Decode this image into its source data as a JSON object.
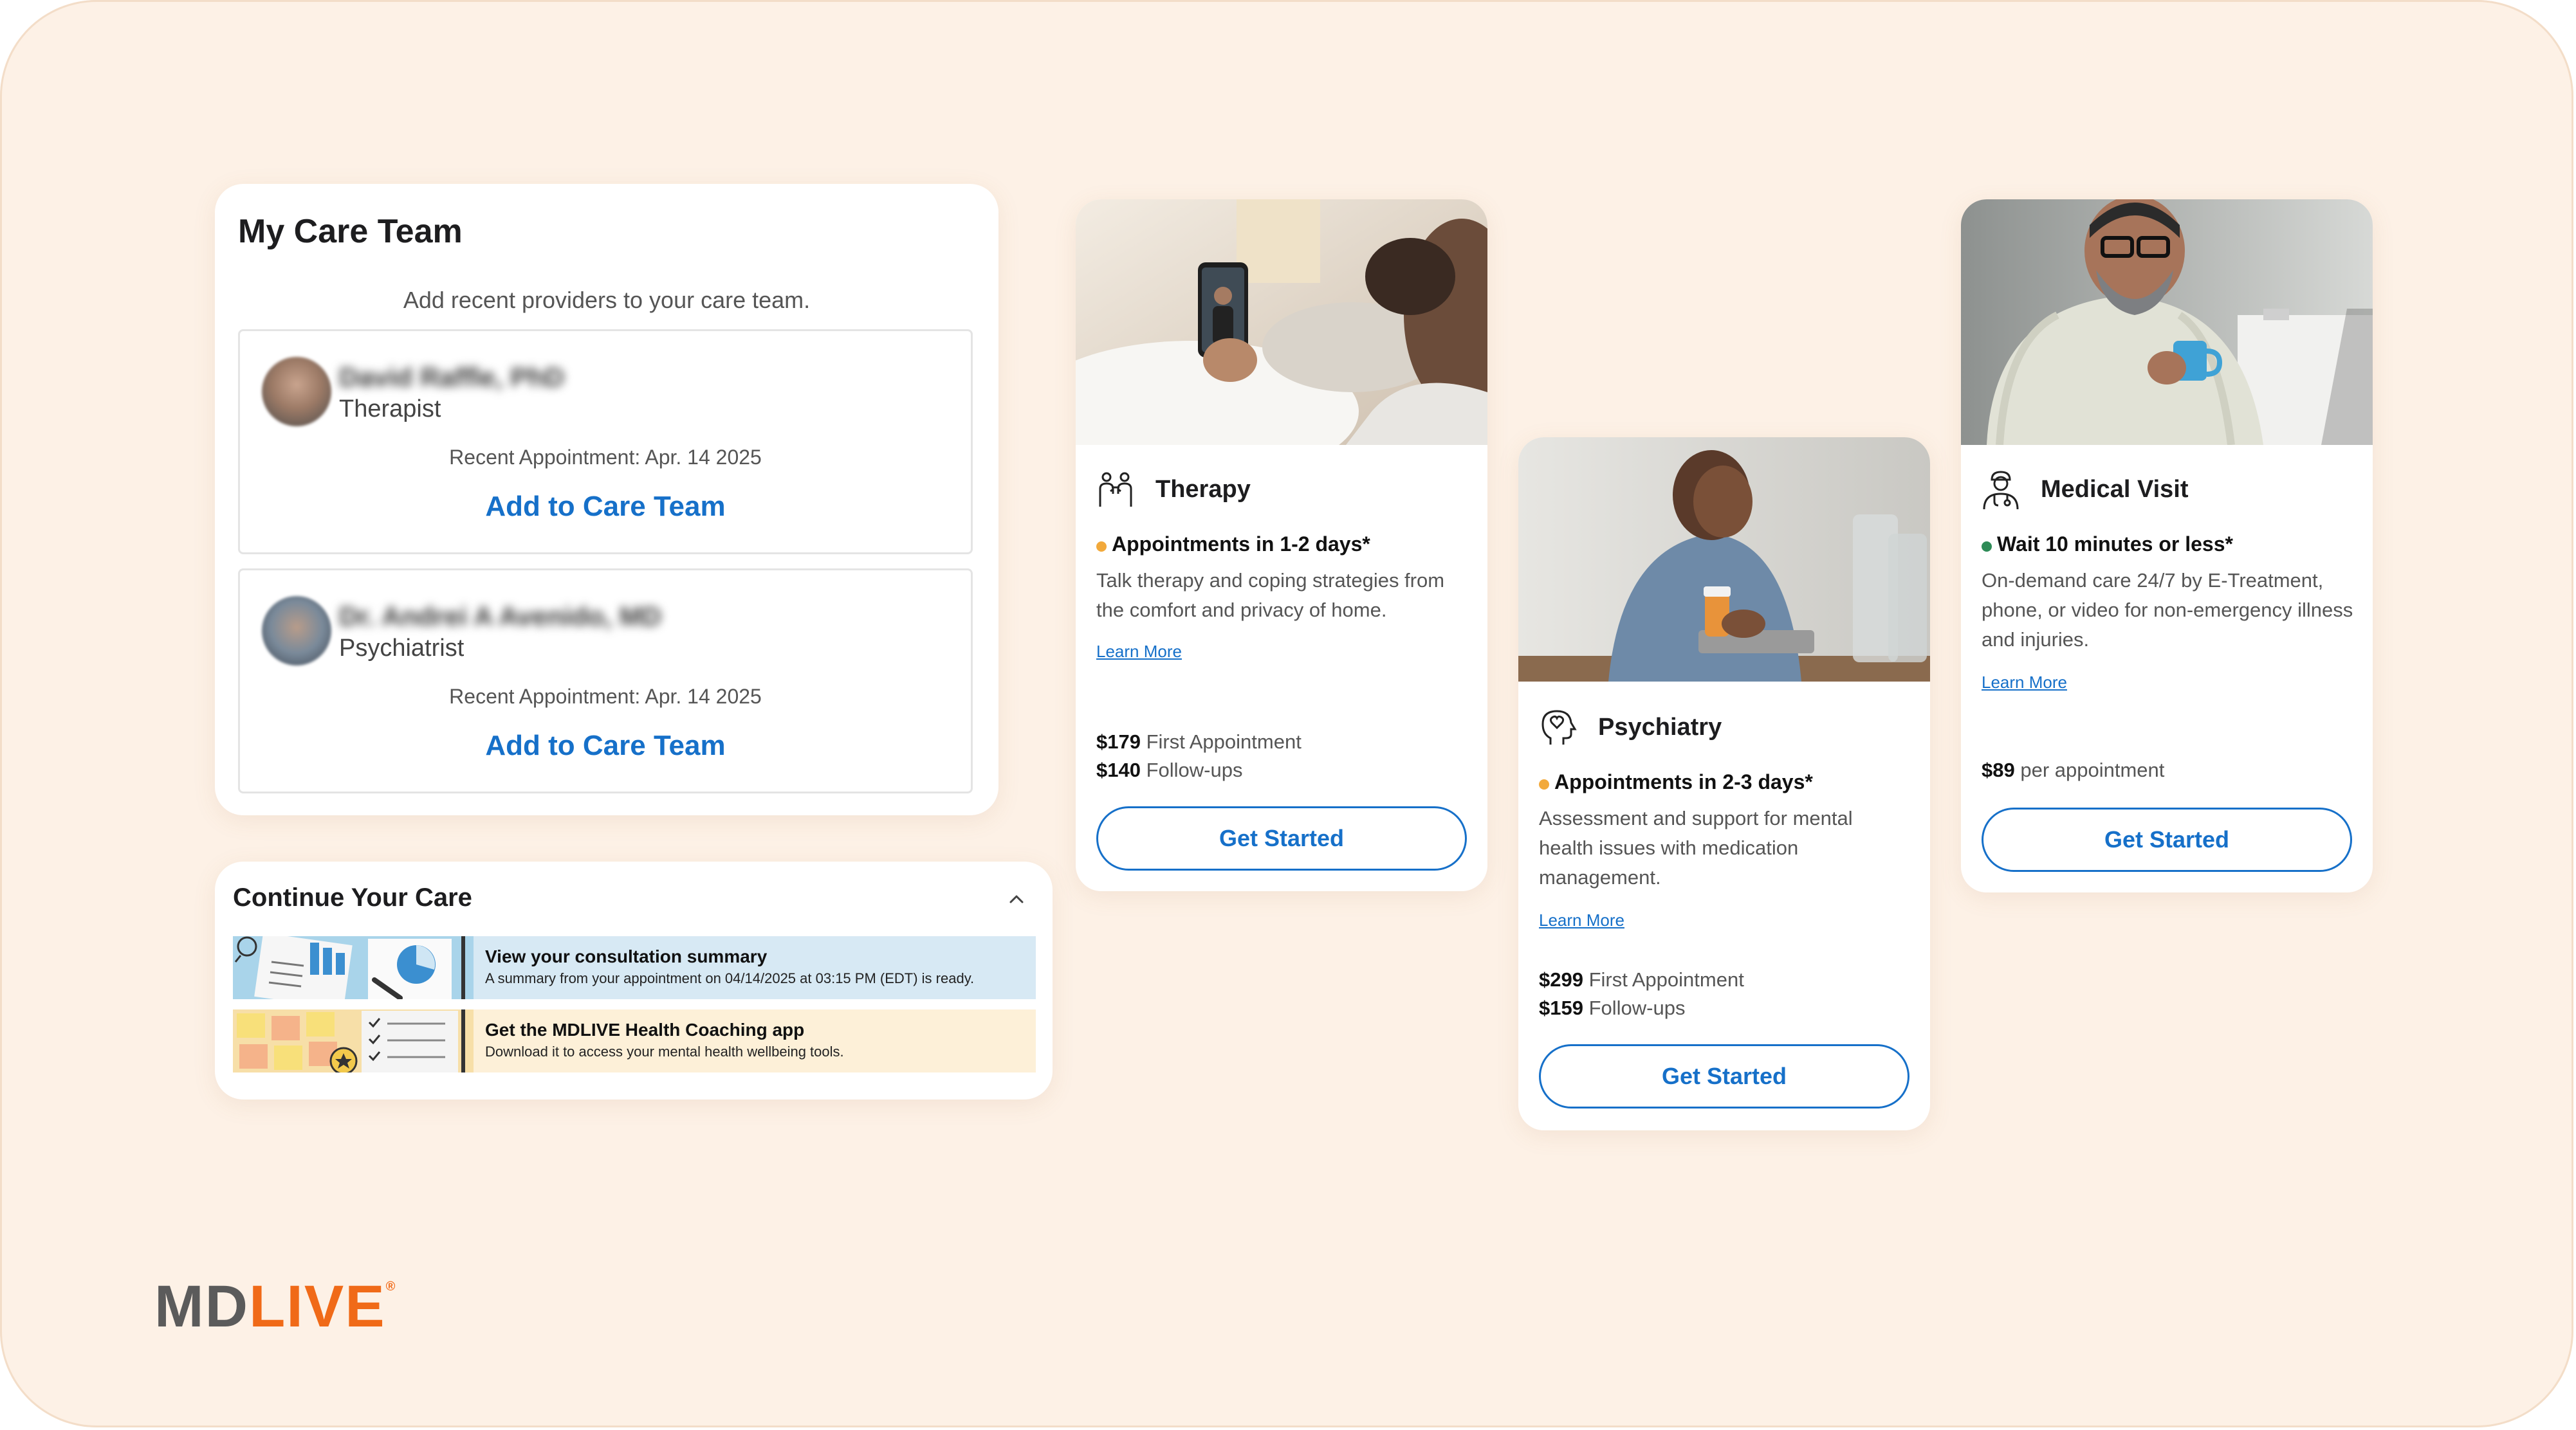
{
  "care_team": {
    "title": "My Care Team",
    "subtitle": "Add recent providers to your care team.",
    "providers": [
      {
        "name": "David Raffle, PhD",
        "role": "Therapist",
        "recent": "Recent Appointment: Apr. 14 2025",
        "action": "Add to Care Team"
      },
      {
        "name": "Dr. Andrei A Avenido, MD",
        "role": "Psychiatrist",
        "recent": "Recent Appointment: Apr. 14 2025",
        "action": "Add to Care Team"
      }
    ]
  },
  "continue_care": {
    "title": "Continue Your Care",
    "items": [
      {
        "title": "View your consultation summary",
        "subtitle": "A summary from your appointment on 04/14/2025 at 03:15 PM (EDT) is ready.",
        "bg": "#d7e9f4"
      },
      {
        "title": "Get the MDLIVE Health Coaching app",
        "subtitle": "Download it to access your mental health wellbeing tools.",
        "bg": "#fdf0d8"
      }
    ]
  },
  "services": {
    "therapy": {
      "title": "Therapy",
      "availability": "Appointments in 1-2 days*",
      "dot_color": "#f2a93b",
      "description": "Talk therapy and coping strategies from the comfort and privacy of home.",
      "learn_more": "Learn More",
      "price1_amount": "$179",
      "price1_label": "First Appointment",
      "price2_amount": "$140",
      "price2_label": "Follow-ups",
      "cta": "Get Started",
      "icon": "therapy-people-icon"
    },
    "psychiatry": {
      "title": "Psychiatry",
      "availability": "Appointments in 2-3 days*",
      "dot_color": "#f2a93b",
      "description": "Assessment and support for mental health issues with medication management.",
      "learn_more": "Learn More",
      "price1_amount": "$299",
      "price1_label": "First Appointment",
      "price2_amount": "$159",
      "price2_label": "Follow-ups",
      "cta": "Get Started",
      "icon": "head-heart-icon"
    },
    "medical": {
      "title": "Medical Visit",
      "availability": "Wait 10 minutes or less*",
      "dot_color": "#2e8b57",
      "description": "On-demand care 24/7 by E-Treatment, phone, or video for non-emergency illness and injuries.",
      "learn_more": "Learn More",
      "price1_amount": "$89",
      "price1_label": "per appointment",
      "cta": "Get Started",
      "icon": "doctor-icon"
    }
  },
  "brand": {
    "logo_part1": "MD",
    "logo_part2": "LIVE",
    "mark": "®",
    "accent": "#f06a18",
    "link_color": "#1670c9"
  }
}
